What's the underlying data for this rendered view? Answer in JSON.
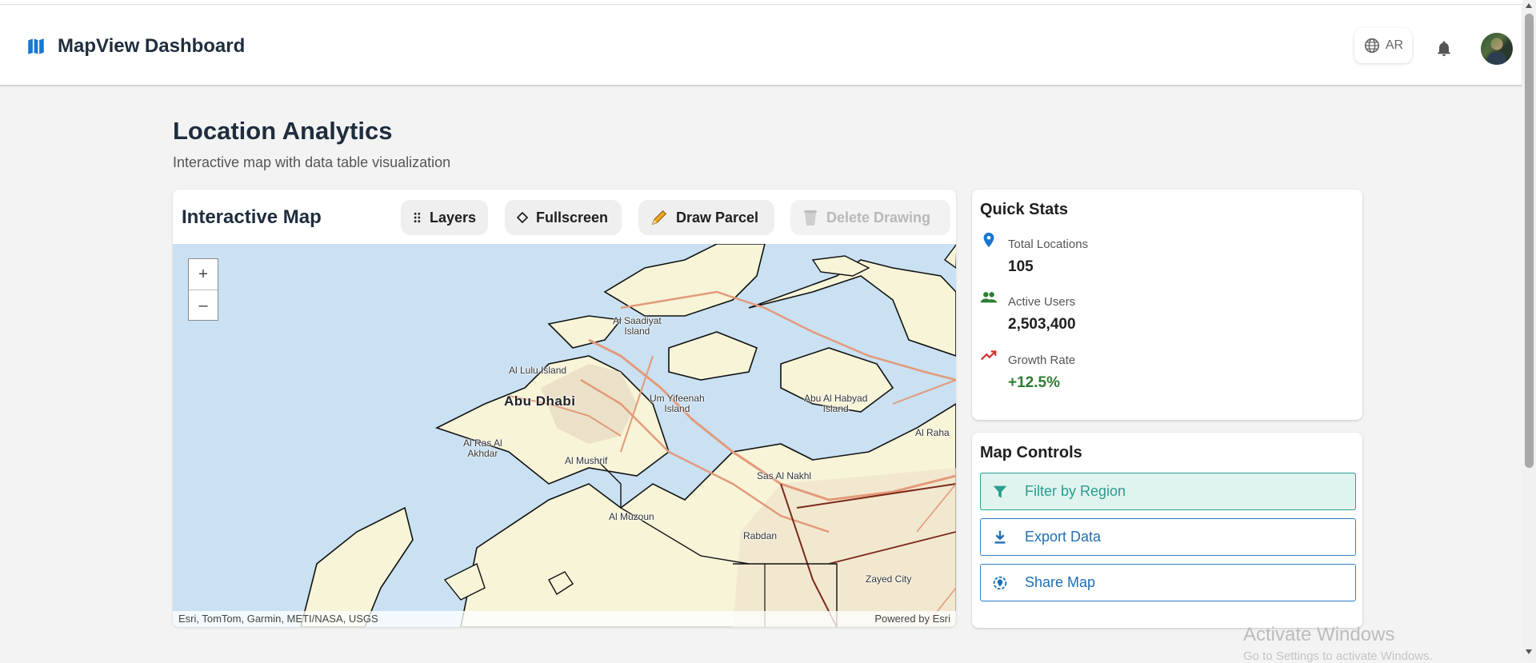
{
  "header": {
    "title": "MapView Dashboard",
    "lang_label": "AR"
  },
  "page": {
    "title": "Location Analytics",
    "subtitle": "Interactive map with data table visualization"
  },
  "map_card": {
    "title": "Interactive Map",
    "toolbar": {
      "layers": "Layers",
      "fullscreen": "Fullscreen",
      "draw_parcel": "Draw Parcel",
      "delete_drawing": "Delete Drawing"
    },
    "zoom_in": "+",
    "zoom_out": "–",
    "labels": {
      "al_saadiyat": "Al Saadiyat\nIsland",
      "al_lulu": "Al Lulu Island",
      "abu_dhabi": "Abu Dhabi",
      "um_yifeenah": "Um Yifeenah\nIsland",
      "abu_al_abyad": "Abu Al Habyad\nIsland",
      "al_ras_al_akhdar": "Al Ras Al\nAkhdar",
      "al_mushrif": "Al Mushrif",
      "sas_al_nakhl": "Sas Al Nakhl",
      "al_muzoun": "Al Muzoun",
      "rabdan": "Rabdan",
      "zayed_city": "Zayed City",
      "al_rahba": "Al Raha"
    },
    "attribution_left": "Esri, TomTom, Garmin, METI/NASA, USGS",
    "attribution_right": "Powered by Esri"
  },
  "stats": {
    "title": "Quick Stats",
    "items": [
      {
        "label": "Total Locations",
        "value": "105",
        "icon": "location-pin-icon",
        "color": "#1976d2"
      },
      {
        "label": "Active Users",
        "value": "2,503,400",
        "icon": "users-icon",
        "color": "#2e7d32"
      },
      {
        "label": "Growth Rate",
        "value": "+12.5%",
        "icon": "trending-up-icon",
        "color": "#d32f2f"
      }
    ]
  },
  "controls": {
    "title": "Map Controls",
    "filter": "Filter by Region",
    "export": "Export Data",
    "share": "Share Map"
  },
  "watermark": {
    "line1": "Activate Windows",
    "line2": "Go to Settings to activate Windows."
  }
}
